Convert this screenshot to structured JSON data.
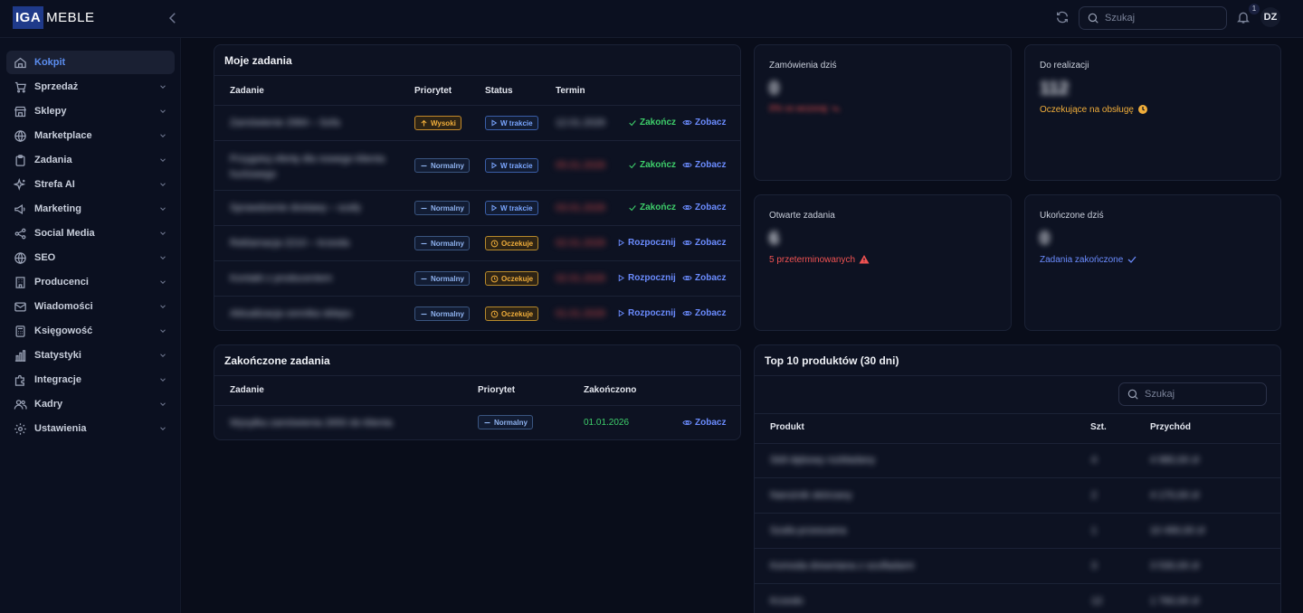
{
  "brand": {
    "logo_mark": "IGA",
    "logo_text": "MEBLE"
  },
  "header": {
    "search_placeholder": "Szukaj",
    "notifications_count": "1",
    "user_initials": "DZ"
  },
  "sidebar": {
    "items": [
      {
        "label": "Kokpit",
        "icon": "home-icon",
        "active": true
      },
      {
        "label": "Sprzedaż",
        "icon": "cart-icon"
      },
      {
        "label": "Sklepy",
        "icon": "store-icon"
      },
      {
        "label": "Marketplace",
        "icon": "globe-icon"
      },
      {
        "label": "Zadania",
        "icon": "clipboard-icon"
      },
      {
        "label": "Strefa AI",
        "icon": "sparkles-icon"
      },
      {
        "label": "Marketing",
        "icon": "megaphone-icon"
      },
      {
        "label": "Social Media",
        "icon": "share-icon"
      },
      {
        "label": "SEO",
        "icon": "globe-icon"
      },
      {
        "label": "Producenci",
        "icon": "building-icon"
      },
      {
        "label": "Wiadomości",
        "icon": "mail-icon"
      },
      {
        "label": "Księgowość",
        "icon": "calculator-icon"
      },
      {
        "label": "Statystyki",
        "icon": "bar-chart-icon"
      },
      {
        "label": "Integracje",
        "icon": "puzzle-icon"
      },
      {
        "label": "Kadry",
        "icon": "users-icon"
      },
      {
        "label": "Ustawienia",
        "icon": "gear-icon"
      }
    ]
  },
  "my_tasks": {
    "title": "Moje zadania",
    "columns": [
      "Zadanie",
      "Priorytet",
      "Status",
      "Termin"
    ],
    "rows": [
      {
        "task": "Zamówienie 2984 – Sofa",
        "priority": "Wysoki",
        "priority_kind": "high",
        "status": "W trakcie",
        "status_kind": "progress",
        "due": "12.01.2026",
        "action": "Zakończ",
        "view": "Zobacz"
      },
      {
        "task": "Przygotuj ofertę dla nowego klienta hurtowego",
        "priority": "Normalny",
        "priority_kind": "normal",
        "status": "W trakcie",
        "status_kind": "progress",
        "due": "05.01.2026",
        "action": "Zakończ",
        "view": "Zobacz"
      },
      {
        "task": "Sprawdzenie dostawy – szafy",
        "priority": "Normalny",
        "priority_kind": "normal",
        "status": "W trakcie",
        "status_kind": "progress",
        "due": "03.01.2026",
        "action": "Zakończ",
        "view": "Zobacz"
      },
      {
        "task": "Reklamacja 2210 – krzesła",
        "priority": "Normalny",
        "priority_kind": "normal",
        "status": "Oczekuje",
        "status_kind": "wait",
        "due": "02.01.2026",
        "action": "Rozpocznij",
        "view": "Zobacz"
      },
      {
        "task": "Kontakt z producentem",
        "priority": "Normalny",
        "priority_kind": "normal",
        "status": "Oczekuje",
        "status_kind": "wait",
        "due": "02.01.2026",
        "action": "Rozpocznij",
        "view": "Zobacz"
      },
      {
        "task": "Aktualizacja cennika sklepu",
        "priority": "Normalny",
        "priority_kind": "normal",
        "status": "Oczekuje",
        "status_kind": "wait",
        "due": "01.01.2026",
        "action": "Rozpocznij",
        "view": "Zobacz"
      }
    ]
  },
  "completed_tasks": {
    "title": "Zakończone zadania",
    "columns": [
      "Zadanie",
      "Priorytet",
      "Zakończono"
    ],
    "rows": [
      {
        "task": "Wysyłka zamówienia 2650 do klienta",
        "priority": "Normalny",
        "completed": "01.01.2026",
        "view": "Zobacz"
      }
    ]
  },
  "stats": {
    "orders_today": {
      "label": "Zamówienia dziś",
      "value": "0",
      "note": "0% vs wczoraj"
    },
    "to_fulfill": {
      "label": "Do realizacji",
      "value": "112",
      "note": "Oczekujące na obsługę"
    },
    "open_tasks": {
      "label": "Otwarte zadania",
      "value": "6",
      "note": "5 przeterminowanych"
    },
    "completed_today": {
      "label": "Ukończone dziś",
      "value": "0",
      "note": "Zadania zakończone"
    }
  },
  "top_products": {
    "title": "Top 10 produktów (30 dni)",
    "search_placeholder": "Szukaj",
    "columns": [
      "Produkt",
      "Szt.",
      "Przychód"
    ],
    "rows": [
      {
        "product": "Stół dębowy rozkładany",
        "qty": "4",
        "revenue": "4 980,00 zł"
      },
      {
        "product": "Narożnik skórzany",
        "qty": "2",
        "revenue": "4 170,00 zł"
      },
      {
        "product": "Szafa przesuwna",
        "qty": "1",
        "revenue": "10 490,00 zł"
      },
      {
        "product": "Komoda drewniana z szufladami",
        "qty": "3",
        "revenue": "3 530,00 zł"
      },
      {
        "product": "Krzesło",
        "qty": "12",
        "revenue": "1 760,00 zł"
      }
    ]
  },
  "colors": {
    "accent": "#5b8def",
    "success": "#3ecf6b",
    "warning": "#f0ad3a",
    "danger": "#f05252",
    "link": "#6b8cff"
  }
}
